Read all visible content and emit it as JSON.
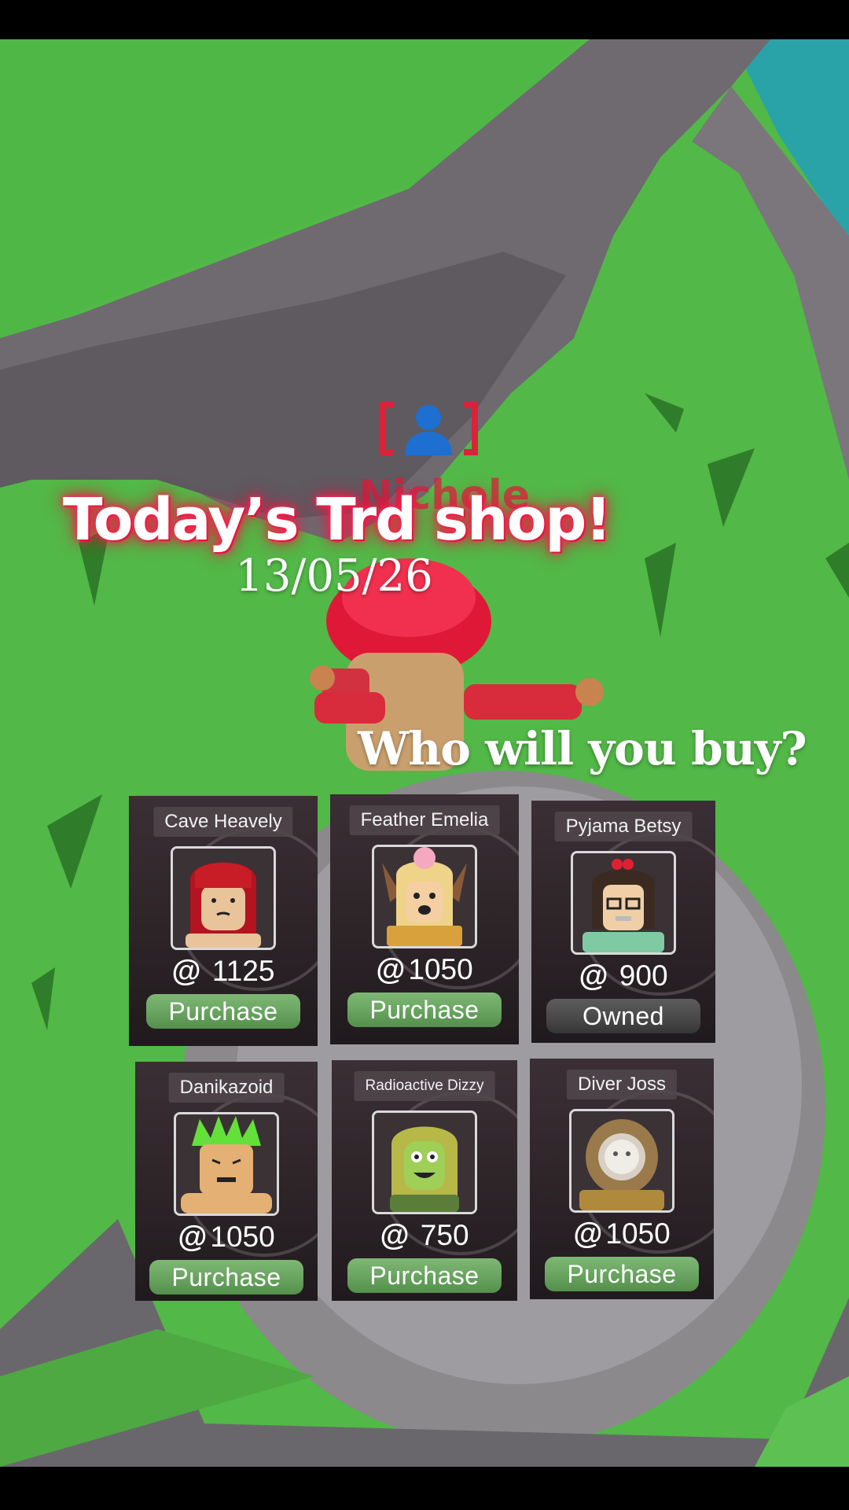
{
  "overlay": {
    "headline": "Today’s Trd shop!",
    "date": "13/05/26",
    "question": "Who will you buy?"
  },
  "game": {
    "overhead_name": "Nichole"
  },
  "shop": {
    "currency_icon": "@",
    "items": [
      {
        "name": "Cave Heavely",
        "price": "1125",
        "action": "Purchase",
        "owned": false
      },
      {
        "name": "Feather Emelia",
        "price": "1050",
        "action": "Purchase",
        "owned": false
      },
      {
        "name": "Pyjama Betsy",
        "price": "900",
        "action": "Owned",
        "owned": true
      },
      {
        "name": "Danikazoid",
        "price": "1050",
        "action": "Purchase",
        "owned": false
      },
      {
        "name": "Radioactive Dizzy",
        "price": "750",
        "action": "Purchase",
        "owned": false
      },
      {
        "name": "Diver Joss",
        "price": "1050",
        "action": "Purchase",
        "owned": false
      }
    ]
  },
  "colors": {
    "grass": "#52b847",
    "path": "#6c686d",
    "headline_glow": "#ff1f4f",
    "purchase_button": "#6aa561",
    "owned_button": "#474747"
  }
}
